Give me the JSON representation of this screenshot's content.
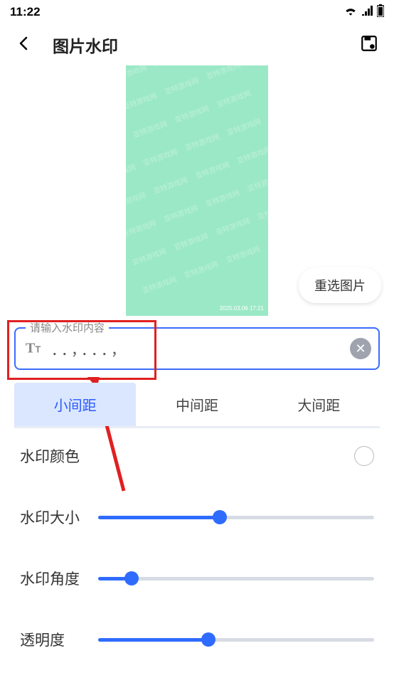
{
  "status": {
    "time": "11:22"
  },
  "appbar": {
    "title": "图片水印"
  },
  "preview": {
    "watermark_text": "亚特游戏网",
    "timestamp": "2025.03.06 17:21",
    "reselect_label": "重选图片"
  },
  "input": {
    "label": "请输入水印内容",
    "value": "．．，．．．，"
  },
  "spacing": {
    "options": [
      "小间距",
      "中间距",
      "大间距"
    ],
    "active_index": 0
  },
  "color_row": {
    "label": "水印颜色",
    "swatch": "#ffffff"
  },
  "sliders": {
    "size": {
      "label": "水印大小",
      "percent": 44
    },
    "angle": {
      "label": "水印角度",
      "percent": 12
    },
    "opacity": {
      "label": "透明度",
      "percent": 40
    }
  },
  "colors": {
    "accent": "#2f6bff",
    "highlight": "#e02020"
  }
}
